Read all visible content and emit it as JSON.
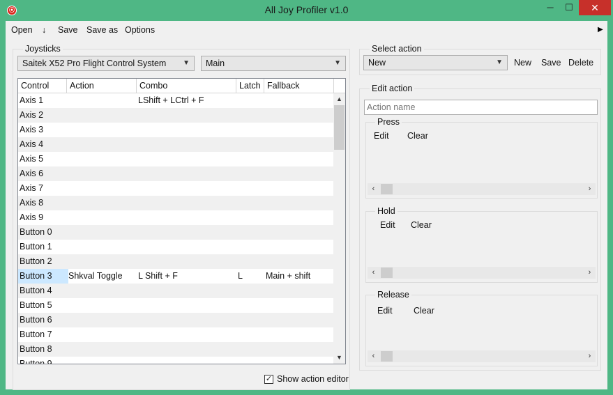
{
  "window": {
    "title": "All Joy Profiler v1.0",
    "icon": "app-logo-icon",
    "minimize": "─",
    "maximize": "☐",
    "close": "✕"
  },
  "menu": {
    "open": "Open",
    "download": "↓",
    "save": "Save",
    "save_as": "Save as",
    "options": "Options",
    "overflow": "▶"
  },
  "joysticks": {
    "label": "Joysticks",
    "device": "Saitek X52 Pro Flight Control System",
    "mode": "Main",
    "columns": [
      "Control",
      "Action",
      "Combo",
      "Latch",
      "Fallback"
    ],
    "rows": [
      {
        "control": "Axis 1",
        "action": "",
        "combo": "LShift + LCtrl + F",
        "latch": "",
        "fallback": ""
      },
      {
        "control": "Axis 2",
        "action": "",
        "combo": "",
        "latch": "",
        "fallback": ""
      },
      {
        "control": "Axis 3",
        "action": "",
        "combo": "",
        "latch": "",
        "fallback": ""
      },
      {
        "control": "Axis 4",
        "action": "",
        "combo": "",
        "latch": "",
        "fallback": ""
      },
      {
        "control": "Axis 5",
        "action": "",
        "combo": "",
        "latch": "",
        "fallback": ""
      },
      {
        "control": "Axis 6",
        "action": "",
        "combo": "",
        "latch": "",
        "fallback": ""
      },
      {
        "control": "Axis 7",
        "action": "",
        "combo": "",
        "latch": "",
        "fallback": ""
      },
      {
        "control": "Axis 8",
        "action": "",
        "combo": "",
        "latch": "",
        "fallback": ""
      },
      {
        "control": "Axis 9",
        "action": "",
        "combo": "",
        "latch": "",
        "fallback": ""
      },
      {
        "control": "Button 0",
        "action": "",
        "combo": "",
        "latch": "",
        "fallback": ""
      },
      {
        "control": "Button 1",
        "action": "",
        "combo": "",
        "latch": "",
        "fallback": ""
      },
      {
        "control": "Button 2",
        "action": "",
        "combo": "",
        "latch": "",
        "fallback": ""
      },
      {
        "control": "Button 3",
        "action": "Shkval Toggle",
        "combo": "L Shift + F",
        "latch": "L",
        "fallback": "Main + shift"
      },
      {
        "control": "Button 4",
        "action": "",
        "combo": "",
        "latch": "",
        "fallback": ""
      },
      {
        "control": "Button 5",
        "action": "",
        "combo": "",
        "latch": "",
        "fallback": ""
      },
      {
        "control": "Button 6",
        "action": "",
        "combo": "",
        "latch": "",
        "fallback": ""
      },
      {
        "control": "Button 7",
        "action": "",
        "combo": "",
        "latch": "",
        "fallback": ""
      },
      {
        "control": "Button 8",
        "action": "",
        "combo": "",
        "latch": "",
        "fallback": ""
      },
      {
        "control": "Button 9",
        "action": "",
        "combo": "",
        "latch": "",
        "fallback": ""
      }
    ],
    "selected_control": "Button 3"
  },
  "select_action": {
    "label": "Select action",
    "value": "New",
    "new": "New",
    "save": "Save",
    "delete": "Delete"
  },
  "edit_action": {
    "label": "Edit action",
    "name_placeholder": "Action name",
    "press": {
      "label": "Press",
      "edit": "Edit",
      "clear": "Clear"
    },
    "hold": {
      "label": "Hold",
      "edit": "Edit",
      "clear": "Clear"
    },
    "release": {
      "label": "Release",
      "edit": "Edit",
      "clear": "Clear"
    }
  },
  "footer": {
    "show_editor_label": "Show action editor",
    "show_editor_checked": true
  },
  "colors": {
    "window_frame": "#4fb785",
    "close_button": "#c7302a",
    "selection": "#cce8ff"
  }
}
